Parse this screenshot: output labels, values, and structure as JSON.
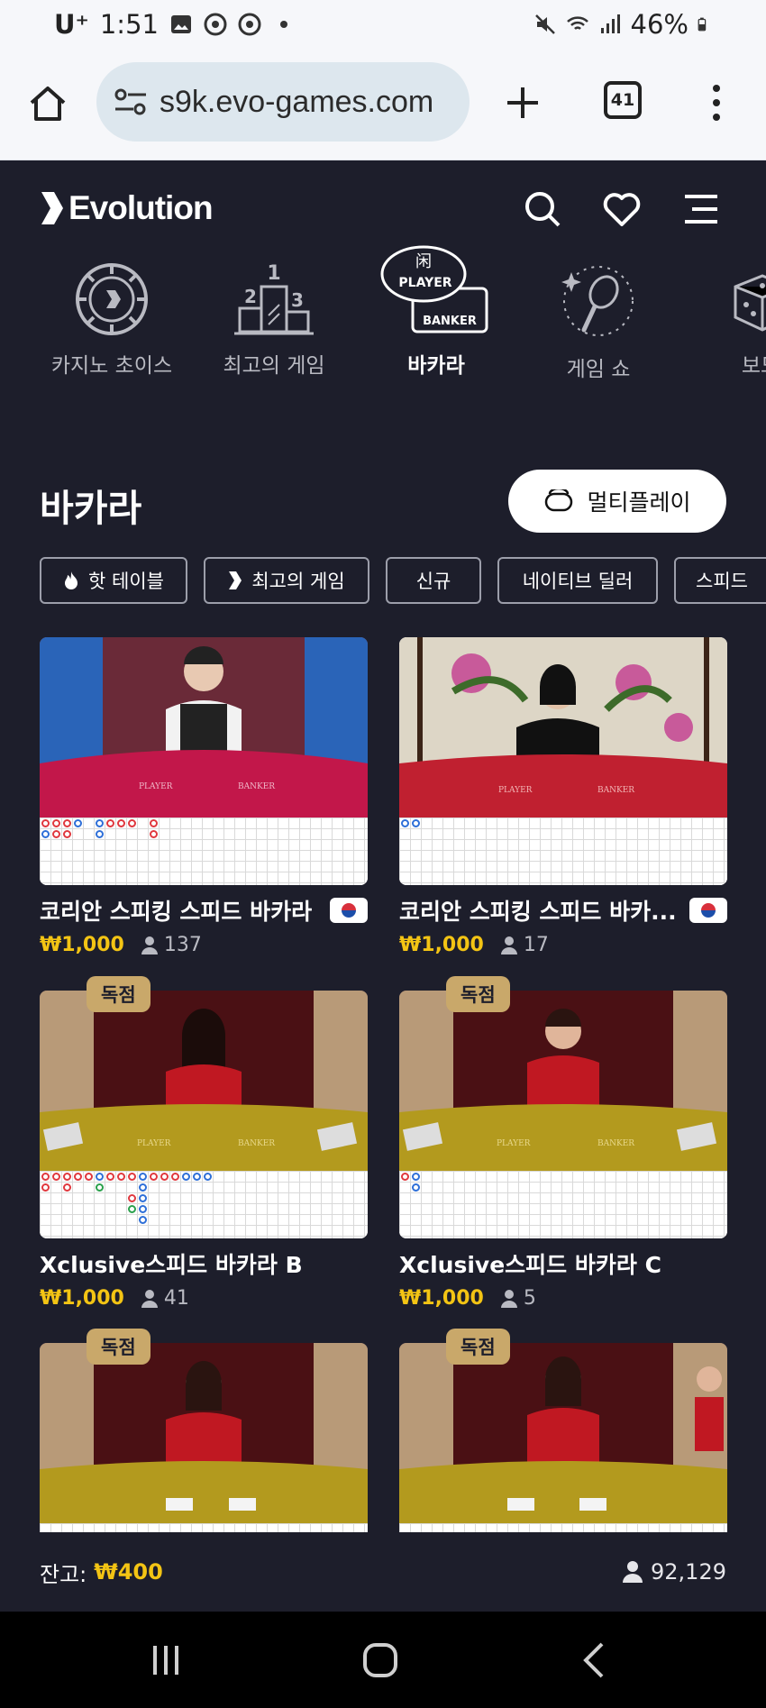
{
  "status": {
    "carrier": "U⁺",
    "time": "1:51",
    "battery": "46%"
  },
  "browser": {
    "url": "s9k.evo-games.com",
    "tab_count": "41"
  },
  "site": {
    "brand": "Evolution"
  },
  "categories": [
    {
      "label": "카지노 초이스",
      "icon": "casino-chip-icon"
    },
    {
      "label": "최고의 게임",
      "icon": "podium-icon"
    },
    {
      "label": "바카라",
      "icon": "baccarat-icon",
      "active": true
    },
    {
      "label": "게임 쇼",
      "icon": "microphone-icon"
    },
    {
      "label": "보드",
      "icon": "dice-icon"
    }
  ],
  "section": {
    "title": "바카라",
    "multiplay_label": "멀티플레이"
  },
  "filters": [
    {
      "label": "핫 테이블",
      "icon": "flame-icon"
    },
    {
      "label": "최고의 게임",
      "icon": "evolution-mark-icon"
    },
    {
      "label": "신규"
    },
    {
      "label": "네이티브 딜러"
    },
    {
      "label": "스피드"
    }
  ],
  "games": [
    {
      "name": "코리안 스피킹 스피드 바카라",
      "price": "₩1,000",
      "players": "137",
      "flag": "korea-flag"
    },
    {
      "name": "코리안 스피킹 스피드 바카...",
      "price": "₩1,000",
      "players": "17",
      "flag": "korea-flag"
    },
    {
      "name": "Xclusive스피드 바카라 B",
      "price": "₩1,000",
      "players": "41",
      "badge": "독점"
    },
    {
      "name": "Xclusive스피드 바카라 C",
      "price": "₩1,000",
      "players": "5",
      "badge": "독점"
    },
    {
      "badge": "독점"
    },
    {
      "badge": "독점"
    }
  ],
  "footer": {
    "balance_label": "잔고:",
    "balance_value": "₩400",
    "online_count": "92,129"
  },
  "colors": {
    "background": "#1d1e2b",
    "price": "#f3c414",
    "badge": "#c9a86a",
    "table_red": "#c2174a",
    "table_gold": "#b39a1e"
  }
}
